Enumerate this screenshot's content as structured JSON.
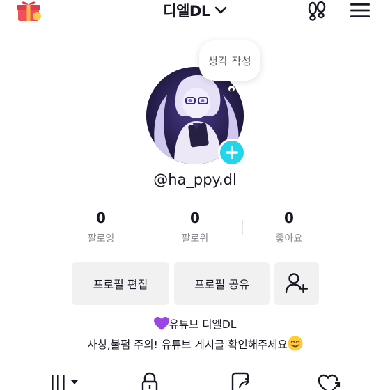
{
  "header": {
    "title": "디엘DL",
    "gift_icon": "gift-icon",
    "footprint_icon": "footprints-icon",
    "menu_icon": "hamburger-menu-icon",
    "dropdown_icon": "chevron-down-icon"
  },
  "profile": {
    "thought_bubble": "생각 작성",
    "username": "@ha_ppy.dl",
    "add_icon": "plus-icon",
    "accent_color": "#20d5ec"
  },
  "stats": [
    {
      "value": "0",
      "label": "팔로잉"
    },
    {
      "value": "0",
      "label": "팔로워"
    },
    {
      "value": "0",
      "label": "좋아요"
    }
  ],
  "actions": {
    "edit_profile": "프로필 편집",
    "share_profile": "프로필 공유",
    "add_friend_icon": "add-user-icon"
  },
  "bio": {
    "line1": "유튜브 디엘DL",
    "line2": "사칭,불펌 주의! 유튜브 게시글 확인해주세요",
    "line1_emoji": "purple-heart-emoji",
    "line2_emoji": "smiling-face-emoji"
  },
  "tabs": [
    {
      "icon": "grid-icon"
    },
    {
      "icon": "lock-icon"
    },
    {
      "icon": "repost-icon"
    },
    {
      "icon": "liked-icon"
    }
  ]
}
